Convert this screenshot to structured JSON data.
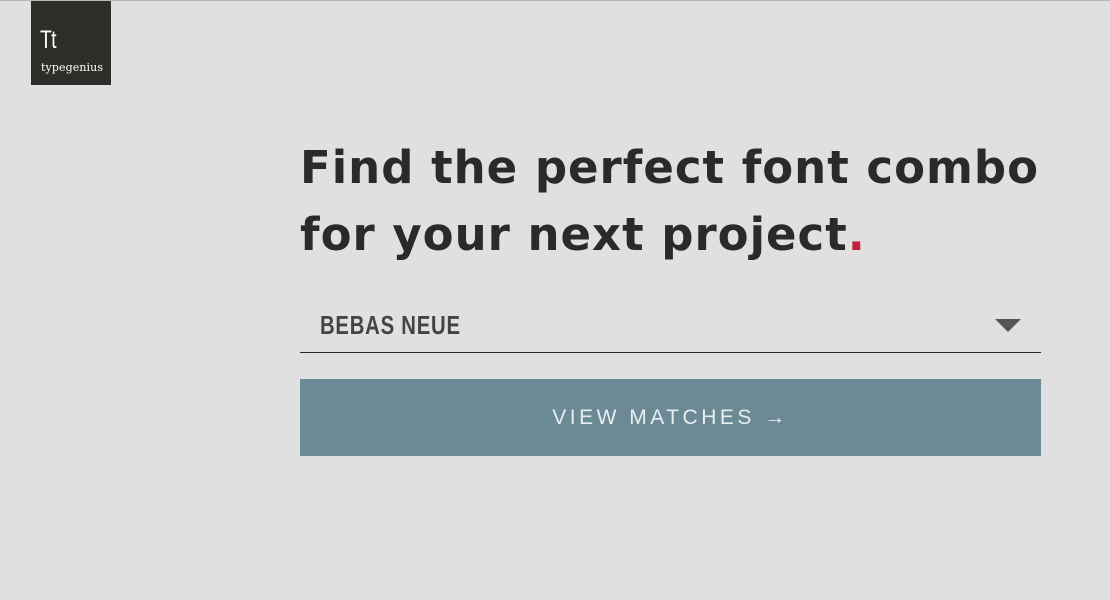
{
  "logo": {
    "mark": "Tt",
    "name": "typegenius"
  },
  "headline": {
    "line1": "Find the perfect font combo",
    "line2": "for your next project",
    "dot": "."
  },
  "font_select": {
    "selected": "BEBAS NEUE",
    "icon": "chevron-down-icon"
  },
  "cta": {
    "label": "VIEW MATCHES →"
  },
  "colors": {
    "background": "#e0e0e0",
    "logo_bg": "#2f2d29",
    "accent_dot": "#c5203b",
    "button": "#6b8a96"
  }
}
